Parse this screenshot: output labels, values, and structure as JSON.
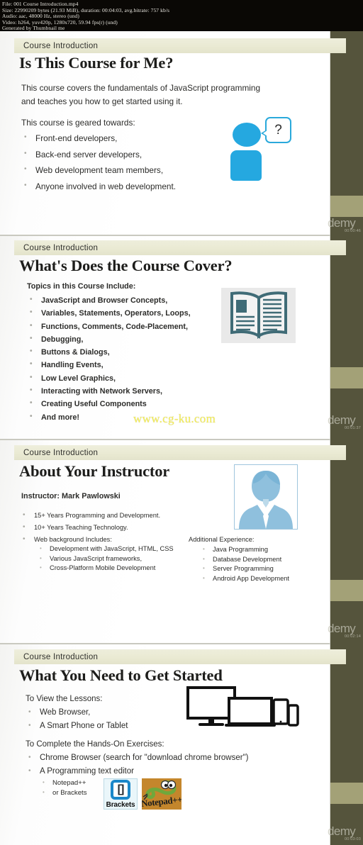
{
  "video_info": {
    "lines": [
      "File: 001 Course Introduction.mp4",
      "Size: 22990209 bytes (21.93 MiB), duration: 00:04:03, avg.bitrate: 757 kb/s",
      "Audio: aac, 48000 Hz, stereo (und)",
      "Video: h264, yuv420p, 1280x720, 59.94 fps(r) (und)",
      "Generated by Thumbnail me"
    ]
  },
  "watermarks": {
    "site": "www.cg-ku.com",
    "udemy_label": "demy",
    "udemy_times": [
      "00:00:46",
      "00:01:37",
      "00:02:14",
      "00:03:03"
    ]
  },
  "slides": [
    {
      "kicker": "Course Introduction",
      "title": "Is This Course for Me?",
      "intro": [
        "This course covers the fundamentals of JavaScript programming",
        "and teaches you how to get started using it."
      ],
      "lead": "This course is geared towards:",
      "bullets": [
        "Front-end developers,",
        "Back-end server developers,",
        "Web development team members,",
        "Anyone involved in web development."
      ],
      "graphic": "person-with-question-bubble",
      "bubble_glyph": "?"
    },
    {
      "kicker": "Course Introduction",
      "title": "What's Does the Course Cover?",
      "lead": "Topics in this Course Include:",
      "bullets": [
        "JavaScript and Browser Concepts,",
        "Variables, Statements, Operators, Loops,",
        "Functions, Comments, Code-Placement,",
        "Debugging,",
        "Buttons & Dialogs,",
        "Handling Events,",
        "Low Level Graphics,",
        "Interacting with Network Servers,",
        "Creating Useful Components",
        "And more!"
      ],
      "graphic": "open-book-icon"
    },
    {
      "kicker": "Course Introduction",
      "title": "About Your Instructor",
      "instructor_label": "Instructor: Mark Pawlowski",
      "bullets": [
        "15+ Years Programming and Development.",
        "10+ Years Teaching Technology.",
        "Web background Includes:"
      ],
      "sub_bullets": [
        "Development with JavaScript, HTML, CSS",
        "Various JavaScript frameworks,",
        "Cross-Platform Mobile Development"
      ],
      "right_heading": "Additional Experience:",
      "right_bullets": [
        "Java Programming",
        "Database Development",
        "Server Programming",
        "Android App Development"
      ],
      "graphic": "instructor-avatar-photo"
    },
    {
      "kicker": "Course Introduction",
      "title": "What You Need to Get Started",
      "lead_a": "To View the Lessons:",
      "bullets_a": [
        "Web Browser,",
        "A Smart Phone or Tablet"
      ],
      "lead_b": "To Complete the Hands-On Exercises:",
      "bullets_b": [
        "Chrome Browser (search for \"download chrome browser\")",
        "A Programming text editor"
      ],
      "sub_bullets_b": [
        "Notepad++",
        "or Brackets"
      ],
      "graphic": "devices-monitor-laptop-tablet-phone",
      "logos": [
        {
          "name": "Brackets",
          "glyph": "[]"
        },
        {
          "name": "Notepad++",
          "glyph": "Notepad++"
        }
      ]
    }
  ]
}
